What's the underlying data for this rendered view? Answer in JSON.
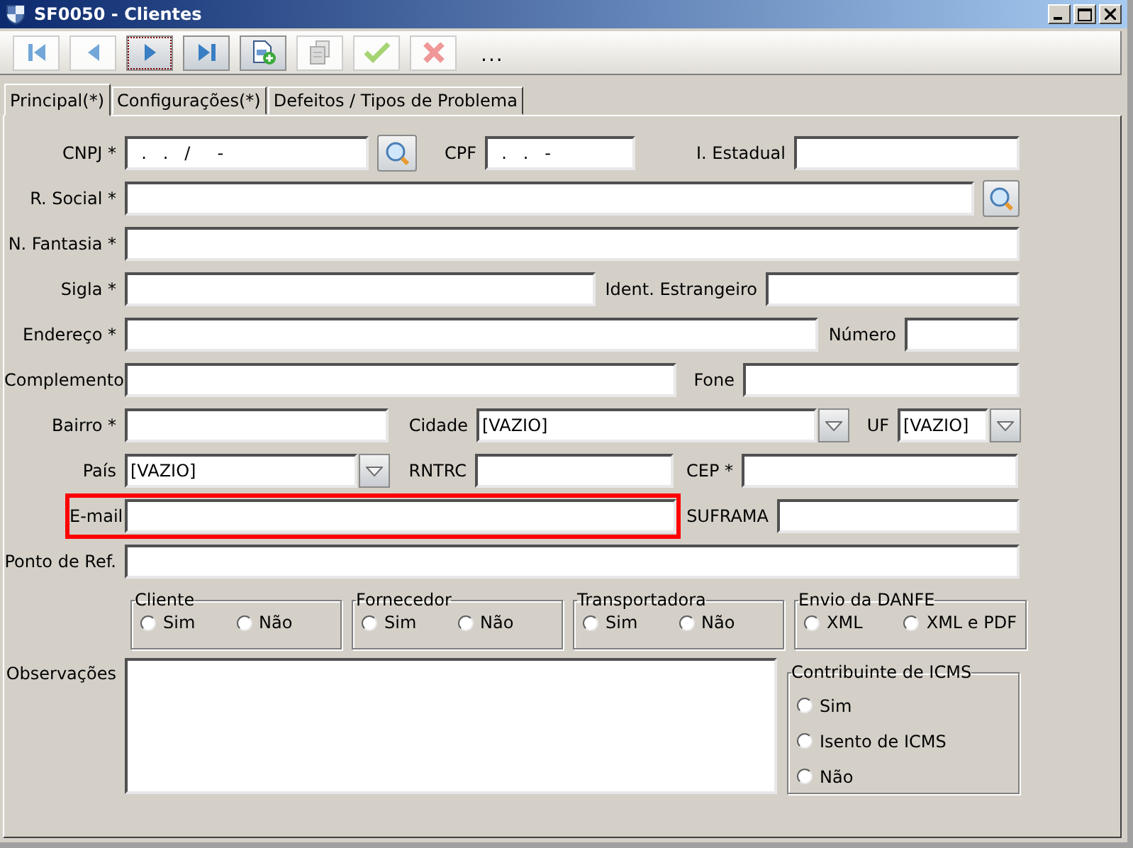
{
  "window": {
    "title": "SF0050 - Clientes"
  },
  "toolbar": {
    "buttons": [
      {
        "kind": "first",
        "disabled": true,
        "focused": false
      },
      {
        "kind": "previous",
        "disabled": true,
        "focused": false
      },
      {
        "kind": "next",
        "disabled": false,
        "focused": true
      },
      {
        "kind": "last",
        "disabled": false,
        "focused": false
      },
      {
        "kind": "new",
        "disabled": false,
        "focused": false
      },
      {
        "kind": "copy",
        "disabled": true,
        "focused": false
      },
      {
        "kind": "confirm",
        "disabled": true,
        "focused": false
      },
      {
        "kind": "cancel",
        "disabled": true,
        "focused": false
      }
    ],
    "more": "..."
  },
  "tabs": [
    {
      "label": "Principal(*)",
      "selected": true
    },
    {
      "label": "Configurações(*)",
      "selected": false
    },
    {
      "label": "Defeitos / Tipos de Problema",
      "selected": false
    }
  ],
  "form": {
    "cnpj": {
      "label": "CNPJ *",
      "value": "  .   .   /     -"
    },
    "cpf": {
      "label": "CPF",
      "value": "  .   .   -"
    },
    "ie": {
      "label": "I. Estadual"
    },
    "razao_social": {
      "label": "R. Social *"
    },
    "nome_fantasia": {
      "label": "N. Fantasia *"
    },
    "sigla": {
      "label": "Sigla *"
    },
    "ident_estrangeiro": {
      "label": "Ident. Estrangeiro"
    },
    "endereco": {
      "label": "Endereço *"
    },
    "numero": {
      "label": "Número"
    },
    "complemento": {
      "label": "Complemento"
    },
    "fone": {
      "label": "Fone"
    },
    "bairro": {
      "label": "Bairro *"
    },
    "cidade": {
      "label": "Cidade",
      "value": "[VAZIO]"
    },
    "uf": {
      "label": "UF",
      "value": "[VAZIO]"
    },
    "pais": {
      "label": "País",
      "value": "[VAZIO]"
    },
    "rntrc": {
      "label": "RNTRC"
    },
    "cep": {
      "label": "CEP *"
    },
    "email": {
      "label": "E-mail",
      "highlighted": true
    },
    "suframa": {
      "label": "SUFRAMA"
    },
    "ponto_ref": {
      "label": "Ponto de Ref."
    },
    "observacoes": {
      "label": "Observações"
    }
  },
  "groups": [
    {
      "title": "Cliente",
      "options": [
        {
          "label": "Sim",
          "selected": false
        },
        {
          "label": "Não",
          "selected": false
        }
      ]
    },
    {
      "title": "Fornecedor",
      "options": [
        {
          "label": "Sim",
          "selected": false
        },
        {
          "label": "Não",
          "selected": false
        }
      ]
    },
    {
      "title": "Transportadora",
      "options": [
        {
          "label": "Sim",
          "selected": false
        },
        {
          "label": "Não",
          "selected": false
        }
      ]
    },
    {
      "title": "Envio da DANFE",
      "options": [
        {
          "label": "XML",
          "selected": false
        },
        {
          "label": "XML e PDF",
          "selected": false
        }
      ]
    }
  ],
  "icms_group": {
    "title": "Contribuinte de ICMS",
    "options": [
      {
        "label": "Sim",
        "selected": false
      },
      {
        "label": "Isento de ICMS",
        "selected": false
      },
      {
        "label": "Não",
        "selected": false
      }
    ]
  }
}
